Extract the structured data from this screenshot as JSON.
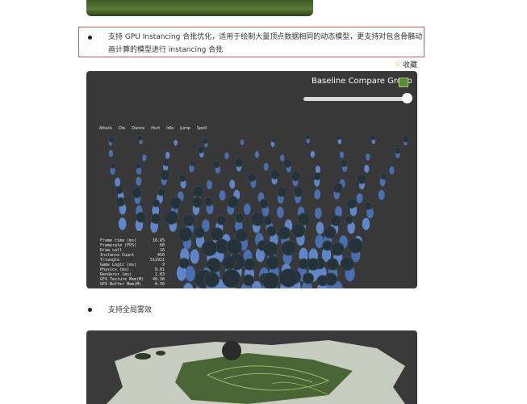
{
  "features": [
    {
      "text_line1": "支持 GPU Instancing 合批优化，适用于绘制大量顶点数据相同的动态模型，更支持对包含骨骼动",
      "text_line2": "画计算的模型进行 instancing 合批"
    },
    {
      "text_line1": "支持全局雾效"
    }
  ],
  "collect": {
    "label": "收藏",
    "icon": "star-icon"
  },
  "demo": {
    "group_label": "Baseline Compare Group",
    "checkbox_checked": true,
    "slider_value": 1.0,
    "anim_labels": [
      "Attack",
      "Die",
      "Dance",
      "Hurt",
      "Idle",
      "Jump",
      "Spell"
    ],
    "stats": [
      {
        "label": "Frame time (ms)",
        "value": "16.65"
      },
      {
        "label": "Framerate (FPS)",
        "value": "60"
      },
      {
        "label": "Draw call",
        "value": "16"
      },
      {
        "label": "Instance Count",
        "value": "450"
      },
      {
        "label": "Triangle",
        "value": "512921"
      },
      {
        "label": "Game Logic (ms)",
        "value": "9"
      },
      {
        "label": "Physics (ms)",
        "value": "0.01"
      },
      {
        "label": "Renderer (ms)",
        "value": "1.83"
      },
      {
        "label": "GFX Texture Mem(M)",
        "value": "40.38"
      },
      {
        "label": "GFX Buffer Mem(M)",
        "value": "0.56"
      }
    ]
  },
  "colors": {
    "highlight_border": "#e05a5a",
    "panel_bg": "#383838",
    "star": "#e0a020"
  }
}
